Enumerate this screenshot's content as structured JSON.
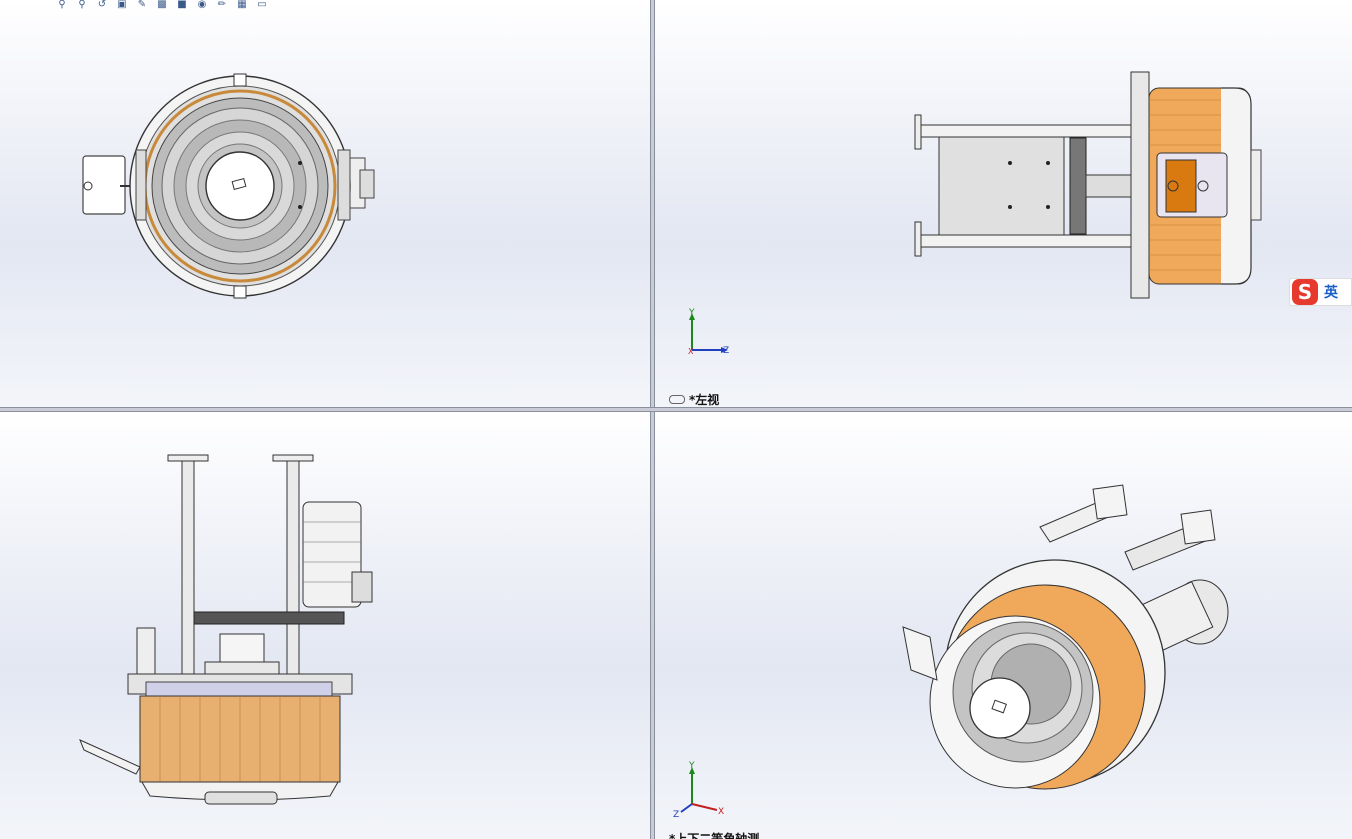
{
  "toolbar": {
    "icons": [
      "zoom-to-fit-icon",
      "zoom-area-icon",
      "previous-view-icon",
      "section-view-icon",
      "dynamic-annotation-icon",
      "view-orientation-icon",
      "display-style-icon",
      "hide-show-icon",
      "edit-appearance-icon",
      "apply-scene-icon",
      "view-settings-icon"
    ]
  },
  "viewports": {
    "top_right": {
      "label": "*左视"
    },
    "bottom_right": {
      "label": "*上下二等角轴测"
    }
  },
  "triad_right": {
    "y": "Y",
    "z": "Z",
    "x": "X"
  },
  "triad_iso": {
    "y": "Y",
    "x": "X",
    "z": "Z"
  },
  "ime": {
    "logo": "S",
    "mode": "英"
  },
  "colors": {
    "accent_orange": "#f0a85a",
    "viewport_bg": "#e6e9f3",
    "metal": "#d8d8d8"
  }
}
